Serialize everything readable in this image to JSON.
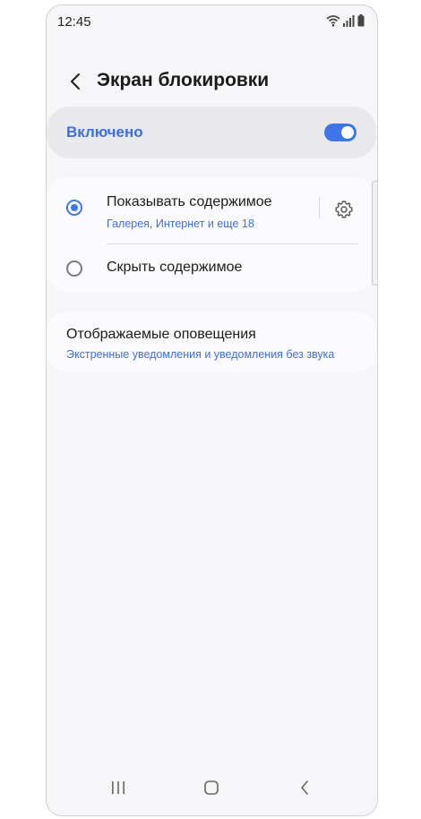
{
  "status_bar": {
    "time": "12:45",
    "icons": [
      "wifi-icon",
      "signal-icon",
      "battery-icon"
    ]
  },
  "header": {
    "back_icon": "chevron-left-icon",
    "title": "Экран блокировки"
  },
  "master_toggle": {
    "label": "Включено",
    "state": "on"
  },
  "options": [
    {
      "label": "Показывать содержимое",
      "sublabel": "Галерея, Интернет и еще 18",
      "selected": true,
      "settings_icon": "gear-icon"
    },
    {
      "label": "Скрыть содержимое",
      "selected": false
    }
  ],
  "notifications": {
    "title": "Отображаемые оповещения",
    "sublabel": "Экстренные уведомления и уведомления без звука"
  },
  "nav_bar": {
    "icons": [
      "recent-apps-icon",
      "home-icon",
      "back-icon"
    ]
  },
  "colors": {
    "accent": "#3e76e8",
    "accent_text": "#3e6fd8",
    "background": "#f6f6f8",
    "card": "#fbfbfd"
  }
}
